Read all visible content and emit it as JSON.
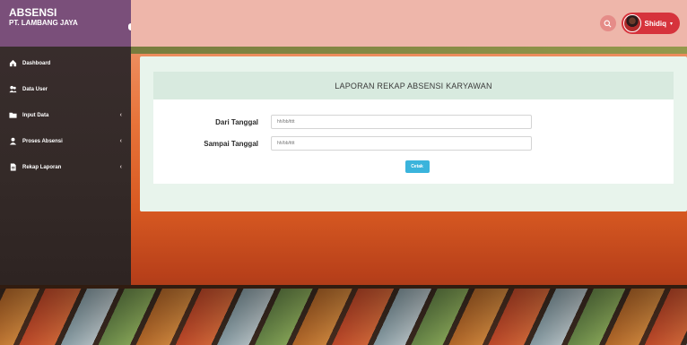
{
  "brand": {
    "title": "ABSENSI",
    "subtitle": "PT. LAMBANG JAYA"
  },
  "topbar": {
    "user_name": "Shidiq",
    "search_icon": "search-icon",
    "accent": "#d6333c"
  },
  "sidebar": {
    "items": [
      {
        "label": "Dashboard",
        "icon": "dashboard-icon",
        "has_submenu": false
      },
      {
        "label": "Data User",
        "icon": "users-icon",
        "has_submenu": false
      },
      {
        "label": "Input Data",
        "icon": "folder-icon",
        "has_submenu": true
      },
      {
        "label": "Proses Absensi",
        "icon": "user-icon",
        "has_submenu": true
      },
      {
        "label": "Rekap Laporan",
        "icon": "document-icon",
        "has_submenu": true
      }
    ]
  },
  "main": {
    "card_title": "LAPORAN REKAP ABSENSI KARYAWAN",
    "form": {
      "from_label": "Dari Tanggal",
      "from_placeholder": "hh/bb/tttt",
      "to_label": "Sampai Tanggal",
      "to_placeholder": "hh/bb/tttt",
      "submit_label": "Cetak"
    }
  },
  "colors": {
    "sidebar_brand": "#7a4f7a",
    "topbar": "#eeb6aa",
    "card_header": "#d8eadf",
    "button": "#3ab4dc"
  }
}
